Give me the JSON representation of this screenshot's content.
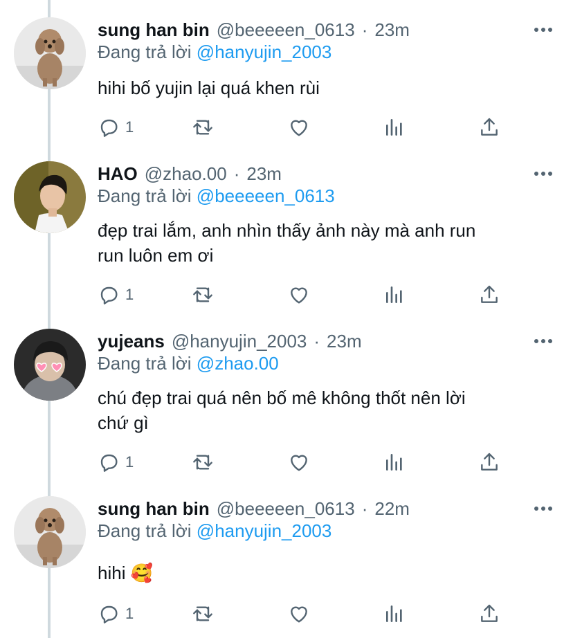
{
  "reply_prefix": "Đang trả lời",
  "separator": "·",
  "tweets": [
    {
      "name": "sung han bin",
      "handle": "@beeeeen_0613",
      "time": "23m",
      "reply_to": "@hanyujin_2003",
      "text_lines": [
        "hihi bố yujin lại quá khen rùi"
      ],
      "reply_count": "1",
      "avatar": "poodle-dog"
    },
    {
      "name": "HAO",
      "handle": "@zhao.00",
      "time": "23m",
      "reply_to": "@beeeeen_0613",
      "text_lines": [
        "đẹp trai lắm, anh nhìn thấy ảnh này mà anh run",
        "run luôn em ơi"
      ],
      "reply_count": "1",
      "avatar": "young-man"
    },
    {
      "name": "yujeans",
      "handle": "@hanyujin_2003",
      "time": "23m",
      "reply_to": "@zhao.00",
      "text_lines": [
        "chú đẹp trai quá nên bố mê không thốt nên lời",
        "chứ gì"
      ],
      "reply_count": "1",
      "avatar": "heart-glasses-person"
    },
    {
      "name": "sung han bin",
      "handle": "@beeeeen_0613",
      "time": "22m",
      "reply_to": "@hanyujin_2003",
      "text_lines": [
        "hihi 🥰"
      ],
      "reply_count": "1",
      "avatar": "poodle-dog"
    }
  ],
  "colors": {
    "accent": "#1d9bf0",
    "secondary_text": "#536471",
    "primary_text": "#0f1419",
    "thread_line": "#cfd9de"
  }
}
